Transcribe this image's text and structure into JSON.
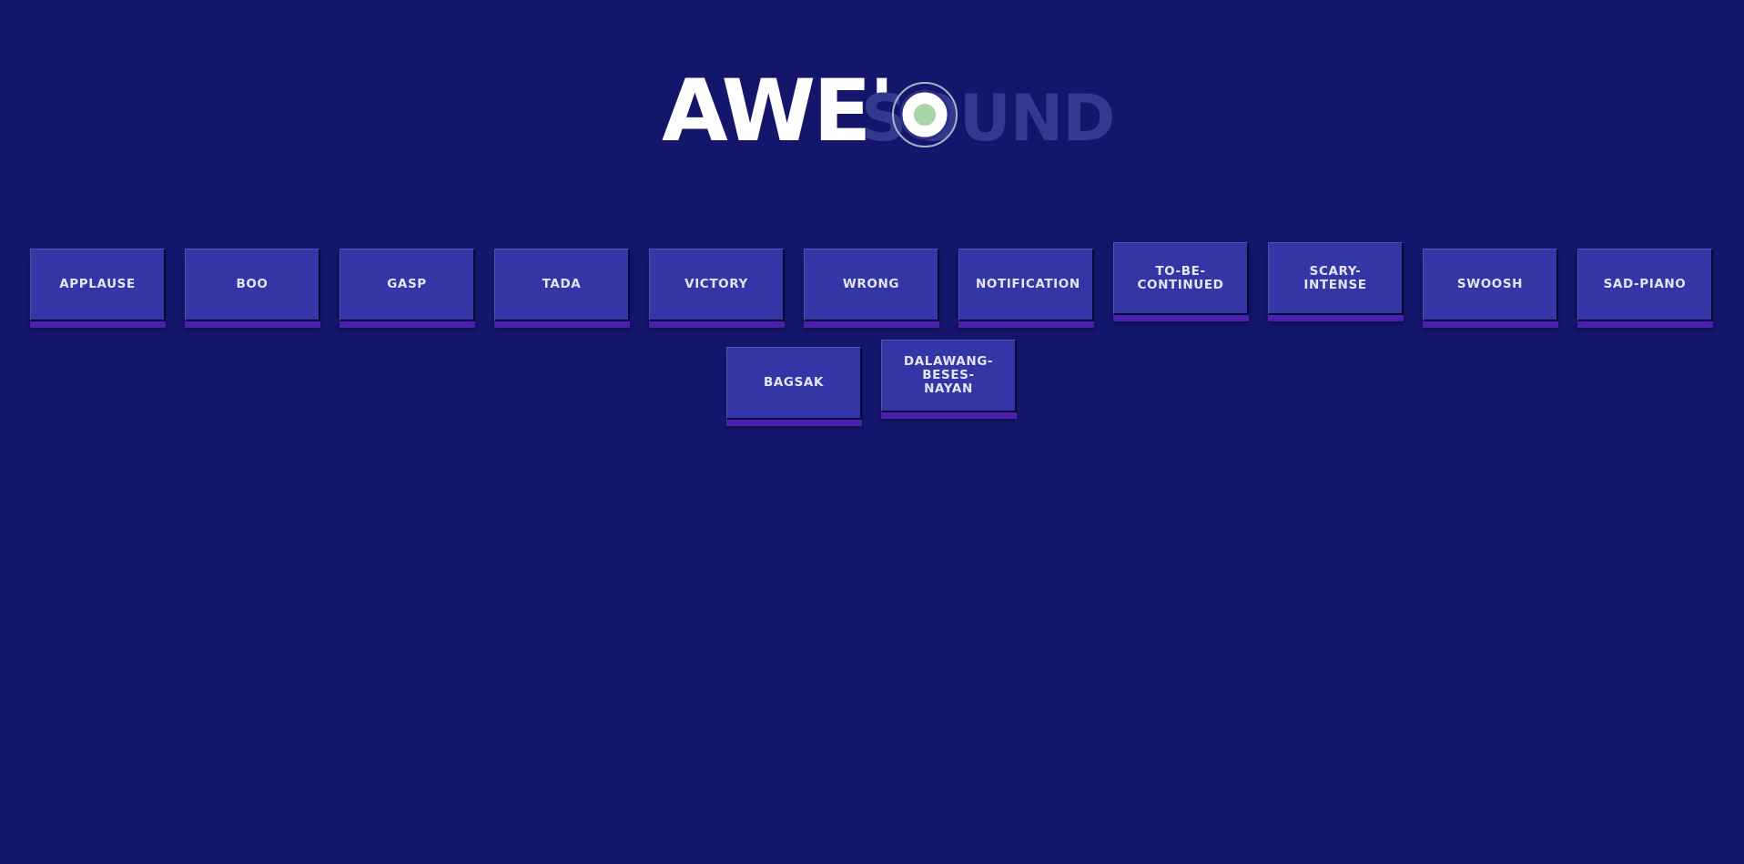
{
  "logo": {
    "part1": "AWE'",
    "part2": "SOUND"
  },
  "colors": {
    "background": "#13166a",
    "button": "#3436a5",
    "button_shadow": "#4c1fb1",
    "logo_primary": "#ffffff",
    "logo_secondary": "#34388e",
    "disc_center": "#a8d4a6"
  },
  "buttons": [
    {
      "label": "APPLAUSE"
    },
    {
      "label": "BOO"
    },
    {
      "label": "GASP"
    },
    {
      "label": "TADA"
    },
    {
      "label": "VICTORY"
    },
    {
      "label": "WRONG"
    },
    {
      "label": "NOTIFICATION"
    },
    {
      "label": "TO-BE-CONTINUED"
    },
    {
      "label": "SCARY-INTENSE"
    },
    {
      "label": "SWOOSH"
    },
    {
      "label": "SAD-PIANO"
    },
    {
      "label": "BAGSAK"
    },
    {
      "label": "DALAWANG-BESES-NAYAN"
    }
  ]
}
